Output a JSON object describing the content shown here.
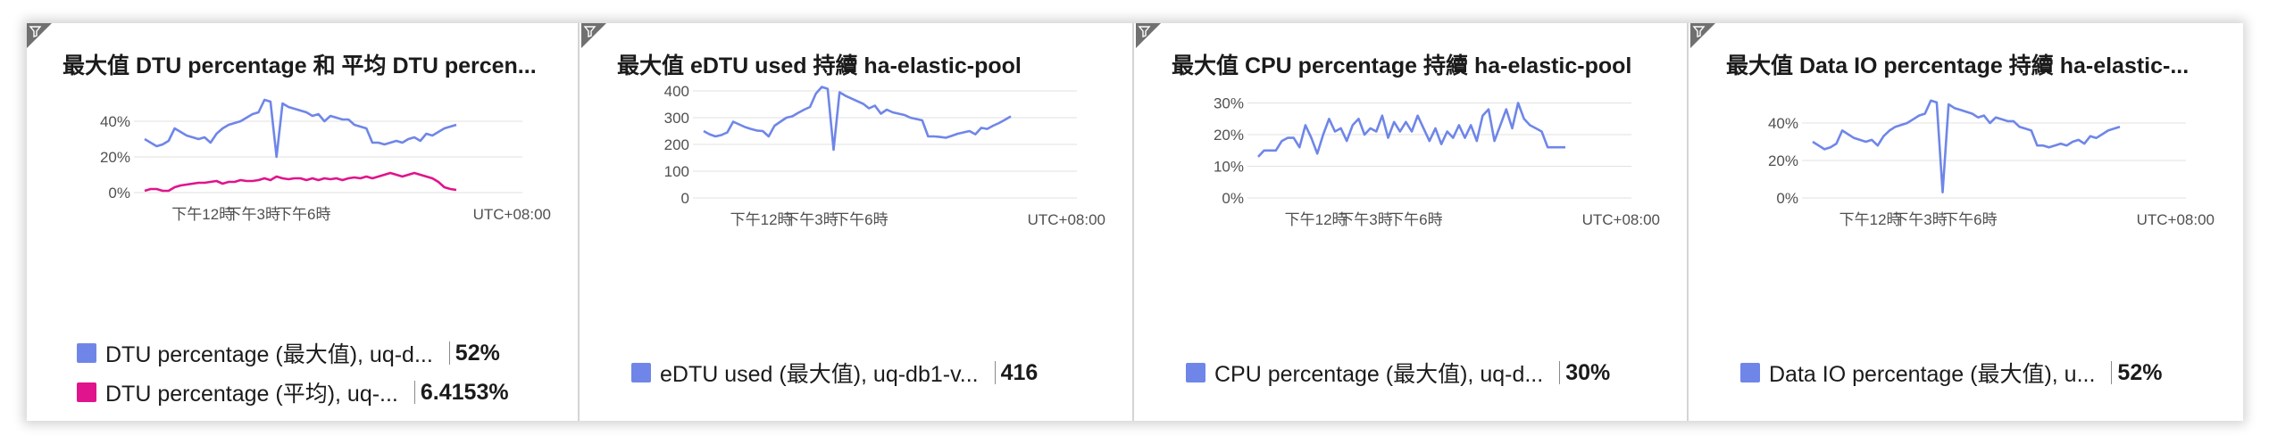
{
  "theme": {
    "accent_blue": "#6f86e8",
    "accent_pink": "#e0148c",
    "grid": "#e1e1e1",
    "corner": "#707070"
  },
  "tiles": [
    {
      "title": "最大值 DTU percentage 和 平均 DTU percen...",
      "filter_icon": "filter-icon",
      "chart_data": {
        "type": "line",
        "title": "最大值 DTU percentage 和 平均 DTU percen...",
        "y_ticks": [
          "0%",
          "20%",
          "40%"
        ],
        "ylim": [
          0,
          60
        ],
        "x_ticks": [
          "下午12時",
          "下午3時",
          "下午6時"
        ],
        "x_right_label": "UTC+08:00",
        "grid": true,
        "series": [
          {
            "name": "DTU percentage (最大值), uq-d...",
            "color": "#6f86e8",
            "values": [
              30,
              28,
              26,
              27,
              29,
              36,
              34,
              32,
              31,
              30,
              31,
              28,
              33,
              36,
              38,
              39,
              40,
              42,
              44,
              45,
              52,
              51,
              20,
              50,
              48,
              47,
              46,
              45,
              43,
              44,
              40,
              43,
              42,
              41,
              41,
              38,
              37,
              36,
              28,
              28,
              27,
              28,
              29,
              28,
              30,
              31,
              29,
              33,
              32,
              34,
              36,
              37,
              38
            ]
          },
          {
            "name": "DTU percentage (平均), uq-...",
            "color": "#e0148c",
            "values": [
              1,
              2,
              2,
              1,
              1,
              3,
              4,
              4.5,
              5,
              5.5,
              5.5,
              6,
              6.5,
              5,
              6,
              6,
              7,
              6.5,
              6.5,
              7,
              8,
              7,
              9,
              8,
              7.5,
              8,
              8,
              7,
              8,
              7,
              8,
              7.5,
              8,
              7,
              8,
              8.5,
              8,
              9,
              8,
              9,
              10,
              11,
              10,
              9,
              10,
              11,
              10,
              9,
              8,
              6,
              3,
              2,
              1.5
            ]
          }
        ]
      },
      "legend": [
        {
          "label": "DTU percentage (最大值), uq-d...",
          "value": "52%"
        },
        {
          "label": "DTU percentage (平均), uq-...",
          "value": "6.4153%"
        }
      ]
    },
    {
      "title": "最大值 eDTU used 持續 ha-elastic-pool",
      "filter_icon": "filter-icon",
      "chart_data": {
        "type": "line",
        "title": "最大值 eDTU used 持續 ha-elastic-pool",
        "y_ticks": [
          "0",
          "100",
          "200",
          "300",
          "400"
        ],
        "ylim": [
          0,
          420
        ],
        "x_ticks": [
          "下午12時",
          "下午3時",
          "下午6時"
        ],
        "x_right_label": "UTC+08:00",
        "grid": true,
        "series": [
          {
            "name": "eDTU used (最大值), uq-db1-v...",
            "color": "#6f86e8",
            "values": [
              250,
              238,
              230,
              235,
              245,
              285,
              275,
              265,
              258,
              252,
              250,
              230,
              270,
              285,
              300,
              305,
              318,
              330,
              340,
              390,
              415,
              408,
              180,
              395,
              382,
              372,
              362,
              352,
              335,
              345,
              315,
              330,
              320,
              315,
              310,
              300,
              295,
              290,
              230,
              230,
              228,
              225,
              232,
              240,
              245,
              250,
              238,
              262,
              258,
              270,
              280,
              292,
              305
            ]
          }
        ]
      },
      "legend": [
        {
          "label": "eDTU used (最大值), uq-db1-v...",
          "value": "416"
        }
      ]
    },
    {
      "title": "最大值 CPU percentage 持續 ha-elastic-pool",
      "filter_icon": "filter-icon",
      "chart_data": {
        "type": "line",
        "title": "最大值 CPU percentage 持續 ha-elastic-pool",
        "y_ticks": [
          "0%",
          "10%",
          "20%",
          "30%"
        ],
        "ylim": [
          0,
          31
        ],
        "x_ticks": [
          "下午12時",
          "下午3時",
          "下午6時"
        ],
        "x_right_label": "UTC+08:00",
        "grid": true,
        "series": [
          {
            "name": "CPU percentage (最大值), uq-d...",
            "color": "#6f86e8",
            "values": [
              13,
              15,
              15,
              15,
              18,
              19,
              19,
              16,
              23,
              19,
              14,
              20,
              25,
              21,
              22,
              18,
              23,
              25,
              20,
              22,
              21,
              26,
              19,
              24,
              21,
              24,
              21,
              26,
              22,
              18,
              22,
              17,
              21,
              19,
              23,
              19,
              23,
              18,
              26,
              28,
              18,
              23,
              28,
              22,
              30,
              25,
              23,
              22,
              21,
              16,
              16,
              16,
              16
            ]
          }
        ]
      },
      "legend": [
        {
          "label": "CPU percentage (最大值), uq-d...",
          "value": "30%"
        }
      ]
    },
    {
      "title": "最大值 Data IO percentage 持續 ha-elastic-...",
      "filter_icon": "filter-icon",
      "chart_data": {
        "type": "line",
        "title": "最大值 Data IO percentage 持續 ha-elastic-...",
        "y_ticks": [
          "0%",
          "20%",
          "40%"
        ],
        "ylim": [
          0,
          60
        ],
        "x_ticks": [
          "下午12時",
          "下午3時",
          "下午6時"
        ],
        "x_right_label": "UTC+08:00",
        "grid": true,
        "series": [
          {
            "name": "Data IO percentage (最大值), u...",
            "color": "#6f86e8",
            "values": [
              30,
              28,
              26,
              27,
              29,
              36,
              34,
              32,
              31,
              30,
              31,
              28,
              33,
              36,
              38,
              39,
              40,
              42,
              44,
              45,
              52,
              51,
              3,
              50,
              48,
              47,
              46,
              45,
              43,
              44,
              40,
              43,
              42,
              41,
              41,
              38,
              37,
              36,
              28,
              28,
              27,
              28,
              29,
              28,
              30,
              31,
              29,
              33,
              32,
              34,
              36,
              37,
              38
            ]
          }
        ]
      },
      "legend": [
        {
          "label": "Data IO percentage (最大值), u...",
          "value": "52%"
        }
      ]
    }
  ]
}
